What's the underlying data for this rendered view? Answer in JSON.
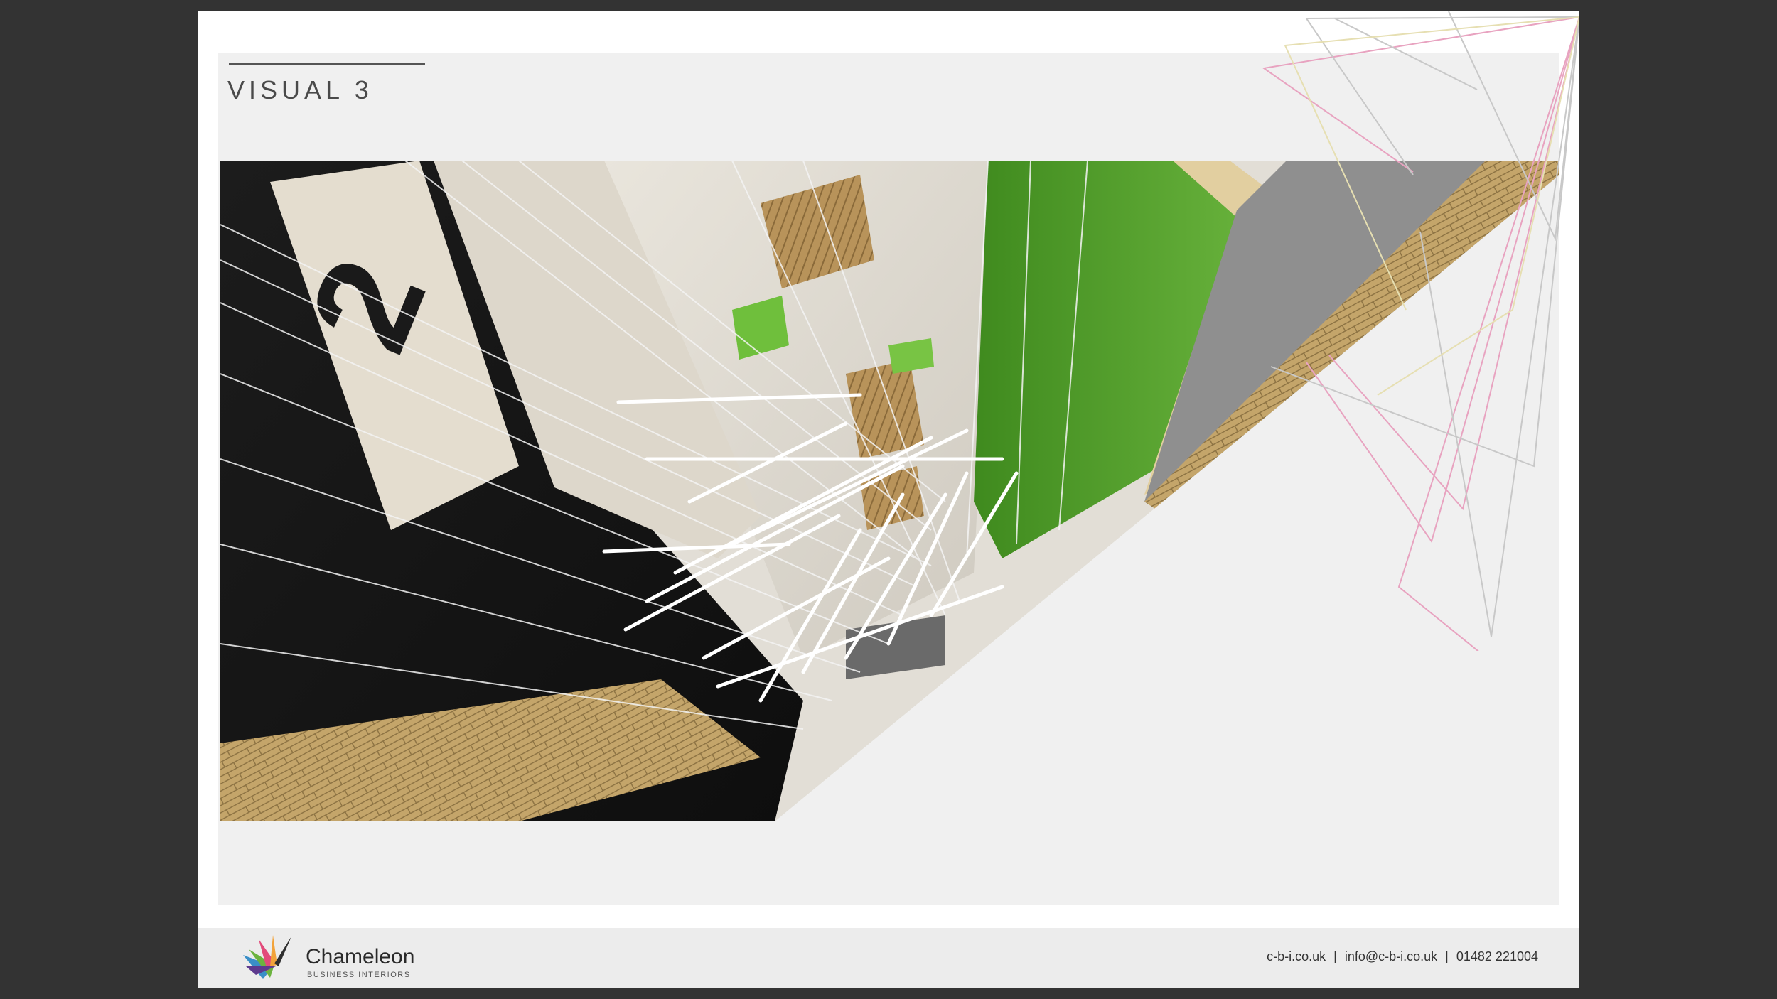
{
  "slide": {
    "title": "VISUAL 3"
  },
  "render": {
    "sign_number": "2"
  },
  "footer": {
    "brand_name": "Chameleon",
    "brand_sub": "BUSINESS INTERIORS",
    "website": "c-b-i.co.uk",
    "email": "info@c-b-i.co.uk",
    "phone": "01482 221004",
    "separator": "|"
  },
  "colors": {
    "viewer_bg": "#333333",
    "panel_bg": "#f0f0f0",
    "footer_bg": "#ececec",
    "green_wall": "#4f9a2a",
    "timber": "#c8ad74",
    "line_pink": "#e8a3c0",
    "line_grey": "#c8c8c8"
  },
  "icons": {
    "logo": "chameleon-logo-icon"
  }
}
